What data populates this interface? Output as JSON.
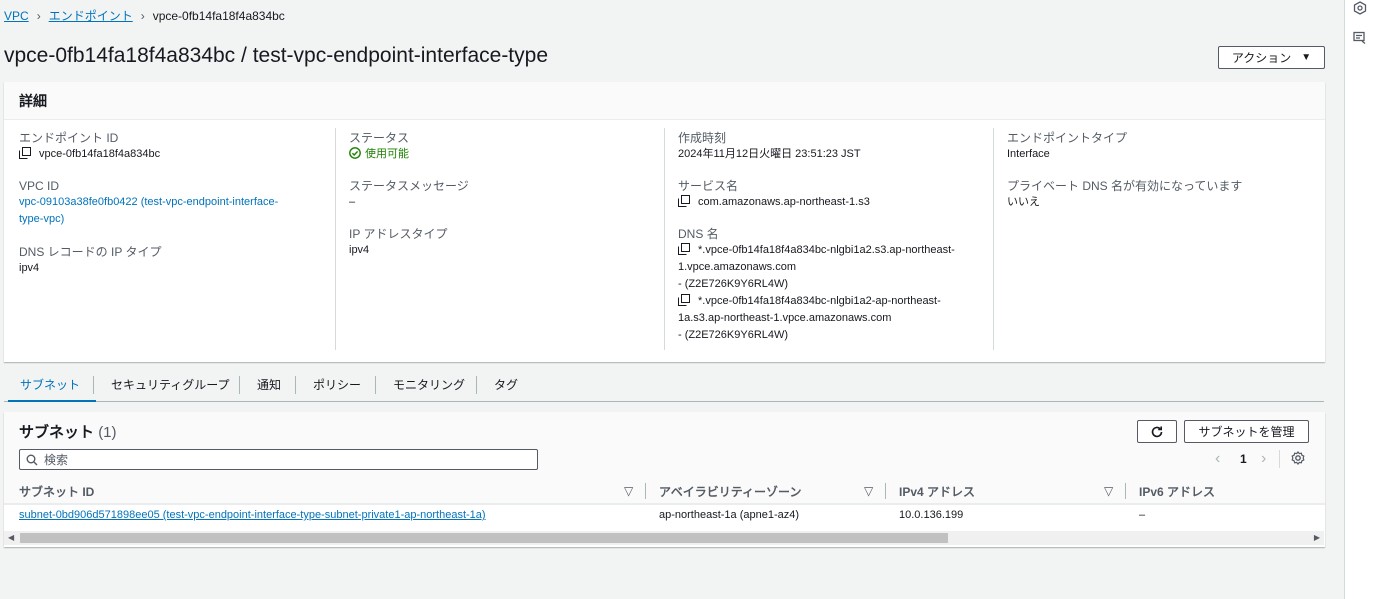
{
  "breadcrumb": {
    "root": "VPC",
    "section": "エンドポイント",
    "current": "vpce-0fb14fa18f4a834bc"
  },
  "page_title": "vpce-0fb14fa18f4a834bc / test-vpc-endpoint-interface-type",
  "actions_label": "アクション",
  "details": {
    "title": "詳細",
    "endpoint_id_label": "エンドポイント ID",
    "endpoint_id": "vpce-0fb14fa18f4a834bc",
    "vpc_id_label": "VPC ID",
    "vpc_id_line1": "vpc-09103a38fe0fb0422 (test-vpc-endpoint-interface-",
    "vpc_id_line2": "type-vpc)",
    "dns_ip_type_label": "DNS レコードの IP タイプ",
    "dns_ip_type": "ipv4",
    "status_label": "ステータス",
    "status": "使用可能",
    "status_message_label": "ステータスメッセージ",
    "status_message": "–",
    "ip_address_type_label": "IP アドレスタイプ",
    "ip_address_type": "ipv4",
    "created_label": "作成時刻",
    "created": "2024年11月12日火曜日 23:51:23 JST",
    "service_name_label": "サービス名",
    "service_name": "com.amazonaws.ap-northeast-1.s3",
    "dns_name_label": "DNS 名",
    "dns1_line1": "*.vpce-0fb14fa18f4a834bc-nlgbi1a2.s3.ap-northeast-",
    "dns1_line2": "1.vpce.amazonaws.com",
    "dns1_line3": "- (Z2E726K9Y6RL4W)",
    "dns2_line1": "*.vpce-0fb14fa18f4a834bc-nlgbi1a2-ap-northeast-",
    "dns2_line2": "1a.s3.ap-northeast-1.vpce.amazonaws.com",
    "dns2_line3": "- (Z2E726K9Y6RL4W)",
    "endpoint_type_label": "エンドポイントタイプ",
    "endpoint_type": "Interface",
    "private_dns_label": "プライベート DNS 名が有効になっています",
    "private_dns": "いいえ"
  },
  "tabs": [
    "サブネット",
    "セキュリティグループ",
    "通知",
    "ポリシー",
    "モニタリング",
    "タグ"
  ],
  "subnets": {
    "title": "サブネット",
    "count": "(1)",
    "manage_label": "サブネットを管理",
    "search_placeholder": "検索",
    "page": "1",
    "columns": [
      "サブネット ID",
      "アベイラビリティーゾーン",
      "IPv4 アドレス",
      "IPv6 アドレス"
    ],
    "rows": [
      {
        "subnet_id": "subnet-0bd906d571898ee05 (test-vpc-endpoint-interface-type-subnet-private1-ap-northeast-1a)",
        "az": "ap-northeast-1a (apne1-az4)",
        "ipv4": "10.0.136.199",
        "ipv6": "–"
      }
    ]
  },
  "colors": {
    "link": "#0073bb",
    "success": "#1d8102",
    "border": "#d5dbdb",
    "bg": "#f2f3f3"
  },
  "icons": [
    "copy-icon",
    "status-ok-icon",
    "refresh-icon",
    "search-icon",
    "settings-icon",
    "chevron-left-icon",
    "chevron-right-icon",
    "sort-icon",
    "caret-down-icon",
    "rail-info-icon",
    "rail-feedback-icon"
  ]
}
